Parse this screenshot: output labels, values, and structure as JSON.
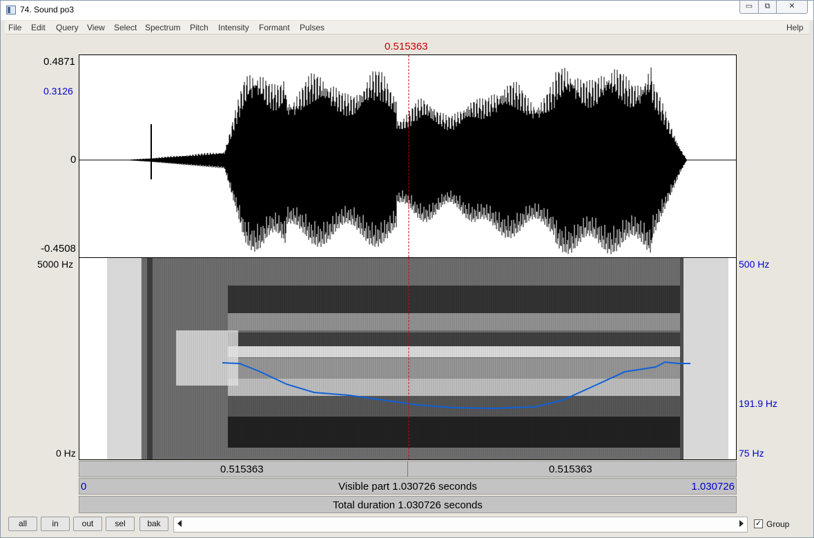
{
  "window": {
    "title": "74. Sound po3",
    "min_glyph": "▭",
    "max_glyph": "⧉",
    "close_glyph": "✕"
  },
  "menu": [
    "File",
    "Edit",
    "Query",
    "View",
    "Select",
    "Spectrum",
    "Pitch",
    "Intensity",
    "Formant",
    "Pulses"
  ],
  "help": "Help",
  "cursor": {
    "time_label": "0.515363",
    "time": 0.515363
  },
  "waveform": {
    "max_label": "0.4871",
    "level_label": "0.3126",
    "zero_label": "0",
    "min_label": "-0.4508"
  },
  "spectrogram": {
    "freq_max_label": "5000 Hz",
    "freq_min_label": "0 Hz"
  },
  "pitch": {
    "top_label": "500 Hz",
    "mid_label": "191.9 Hz",
    "bottom_label": "75 Hz"
  },
  "time_bar": {
    "left_interval": "0.515363",
    "right_interval": "0.515363"
  },
  "visible_bar": {
    "start": "0",
    "label": "Visible part 1.030726 seconds",
    "end": "1.030726"
  },
  "total_bar": {
    "label": "Total duration 1.030726 seconds"
  },
  "buttons": {
    "all": "all",
    "in": "in",
    "out": "out",
    "sel": "sel",
    "bak": "bak"
  },
  "group": {
    "label": "Group",
    "checked": true,
    "check_glyph": "✓"
  },
  "colors": {
    "cursor": "#cc0000",
    "pitch_track": "#1060d8",
    "axis_blue": "#0000cc"
  }
}
